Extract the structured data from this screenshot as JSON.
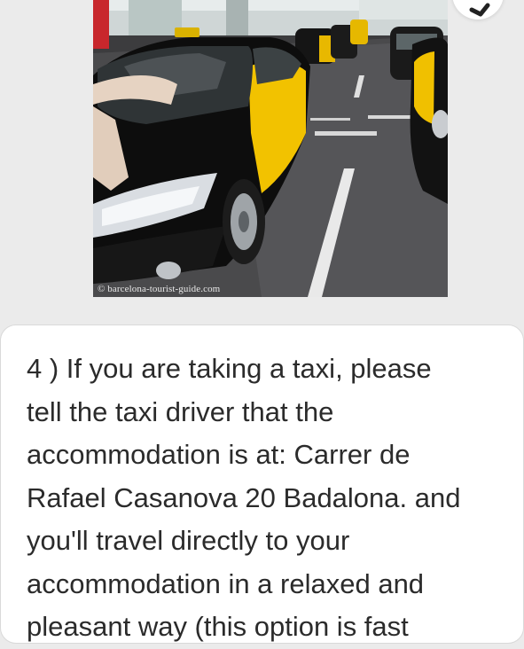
{
  "photo": {
    "watermark": "© barcelona-tourist-guide.com"
  },
  "top_button": {
    "icon": "chevron-icon"
  },
  "message": {
    "text": "4 ) If you are taking a taxi, please\ntell the taxi driver that the\naccommodation is at: Carrer de\nRafael Casanova 20 Badalona. and\nyou'll travel directly to your\naccommodation in a relaxed and\npleasant way (this option is fast"
  },
  "colors": {
    "taxi_black": "#111111",
    "taxi_yellow": "#f2c200",
    "card_bg": "#ffffff",
    "page_bg": "#ebebeb",
    "text": "#2b2b2b"
  }
}
